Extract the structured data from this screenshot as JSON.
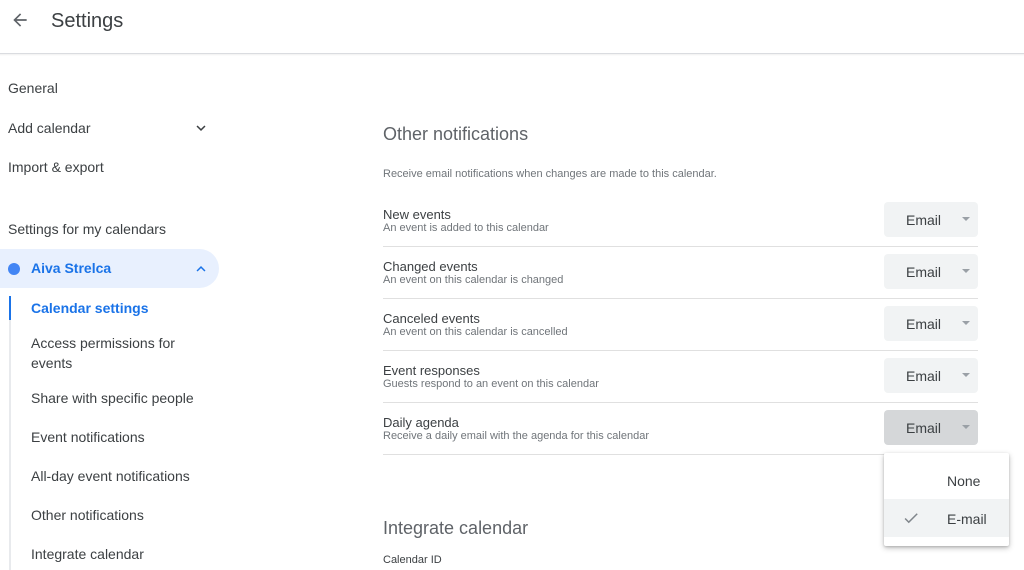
{
  "header": {
    "title": "Settings",
    "back_icon": "arrow-left-icon"
  },
  "sidebar": {
    "top_items": [
      {
        "label": "General"
      },
      {
        "label": "Add calendar",
        "icon": "chevron-down-icon"
      },
      {
        "label": "Import & export"
      }
    ],
    "section_label": "Settings for my calendars",
    "calendar": {
      "name": "Aiva Strelca",
      "color": "#4285f4",
      "expanded": true,
      "icon": "chevron-up-icon"
    },
    "sub_items": [
      {
        "label": "Calendar settings",
        "active": true
      },
      {
        "label": "Access permissions for events"
      },
      {
        "label": "Share with specific people"
      },
      {
        "label": "Event notifications"
      },
      {
        "label": "All-day event notifications"
      },
      {
        "label": "Other notifications"
      },
      {
        "label": "Integrate calendar"
      }
    ]
  },
  "main": {
    "other_notifications": {
      "title": "Other notifications",
      "description": "Receive email notifications when changes are made to this calendar.",
      "rows": [
        {
          "label": "New events",
          "sub": "An event is added to this calendar",
          "value": "Email"
        },
        {
          "label": "Changed events",
          "sub": "An event on this calendar is changed",
          "value": "Email"
        },
        {
          "label": "Canceled events",
          "sub": "An event on this calendar is cancelled",
          "value": "Email"
        },
        {
          "label": "Event responses",
          "sub": "Guests respond to an event on this calendar",
          "value": "Email"
        },
        {
          "label": "Daily agenda",
          "sub": "Receive a daily email with the agenda for this calendar",
          "value": "Email",
          "open": true
        }
      ]
    },
    "dropdown_menu": {
      "options": [
        {
          "label": "None",
          "selected": false
        },
        {
          "label": "E-mail",
          "selected": true,
          "icon": "check-icon"
        }
      ]
    },
    "integrate_calendar": {
      "title": "Integrate calendar",
      "calendar_id_label": "Calendar ID"
    }
  },
  "colors": {
    "accent": "#1a73e8",
    "selected_bg": "#e8f0fe",
    "select_bg": "#f1f3f4"
  }
}
